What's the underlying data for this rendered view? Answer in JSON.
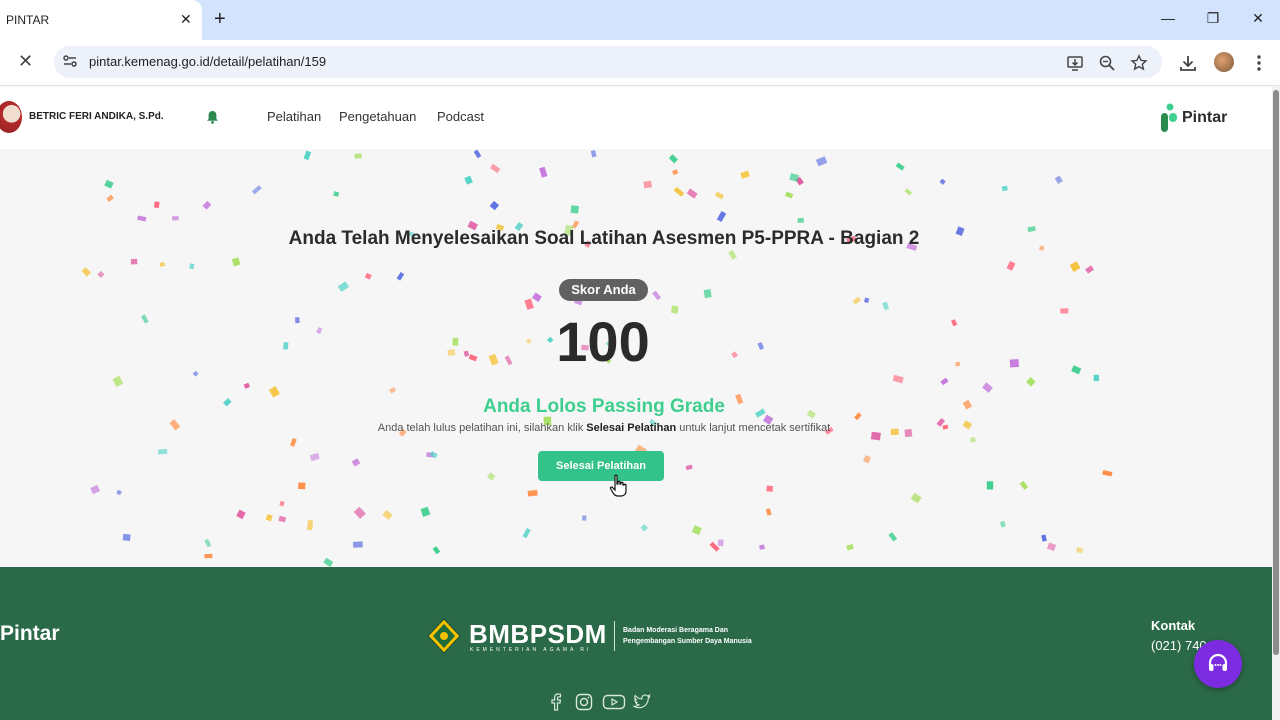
{
  "browser": {
    "tab_title": "PINTAR",
    "tab_close": "✕",
    "new_tab": "+",
    "url": "pintar.kemenag.go.id/detail/pelatihan/159",
    "window_controls": [
      "minimize",
      "restore",
      "close"
    ]
  },
  "header": {
    "user_name": "BETRIC FERI ANDIKA, S.Pd.",
    "nav": [
      "Pelatihan",
      "Pengetahuan",
      "Podcast"
    ],
    "brand": "Pintar"
  },
  "result": {
    "title": "Anda Telah Menyelesaikan Soal Latihan Asesmen P5-PPRA - Bagian 2",
    "score_label": "Skor Anda",
    "score": "100",
    "pass_text": "Anda Lolos Passing Grade",
    "info_before": "Anda telah lulus pelatihan ini, silahkan klik ",
    "info_bold": "Selesai Pelatihan",
    "info_after": " untuk lanjut mencetak sertifikat",
    "button_label": "Selesai Pelatihan"
  },
  "footer": {
    "brand": "Pintar",
    "org_name": "BMBPSDM",
    "org_sub": "KEMENTERIAN AGAMA RI",
    "org_desc_1": "Badan Moderasi Beragama Dan",
    "org_desc_2": "Pengembangan Sumber Daya Manusia",
    "contact_label": "Kontak",
    "contact_phone": "(021) 740"
  },
  "colors": {
    "accent_green": "#33c28a",
    "footer_green": "#2b6a48",
    "support_purple": "#7b2be0"
  },
  "icons": [
    "close-icon",
    "plus-icon",
    "site-info-icon",
    "install-icon",
    "zoom-icon",
    "star-icon",
    "download-icon",
    "menu-icon",
    "bell-icon",
    "facebook-icon",
    "instagram-icon",
    "youtube-icon",
    "twitter-icon",
    "headset-icon",
    "cursor-icon"
  ]
}
